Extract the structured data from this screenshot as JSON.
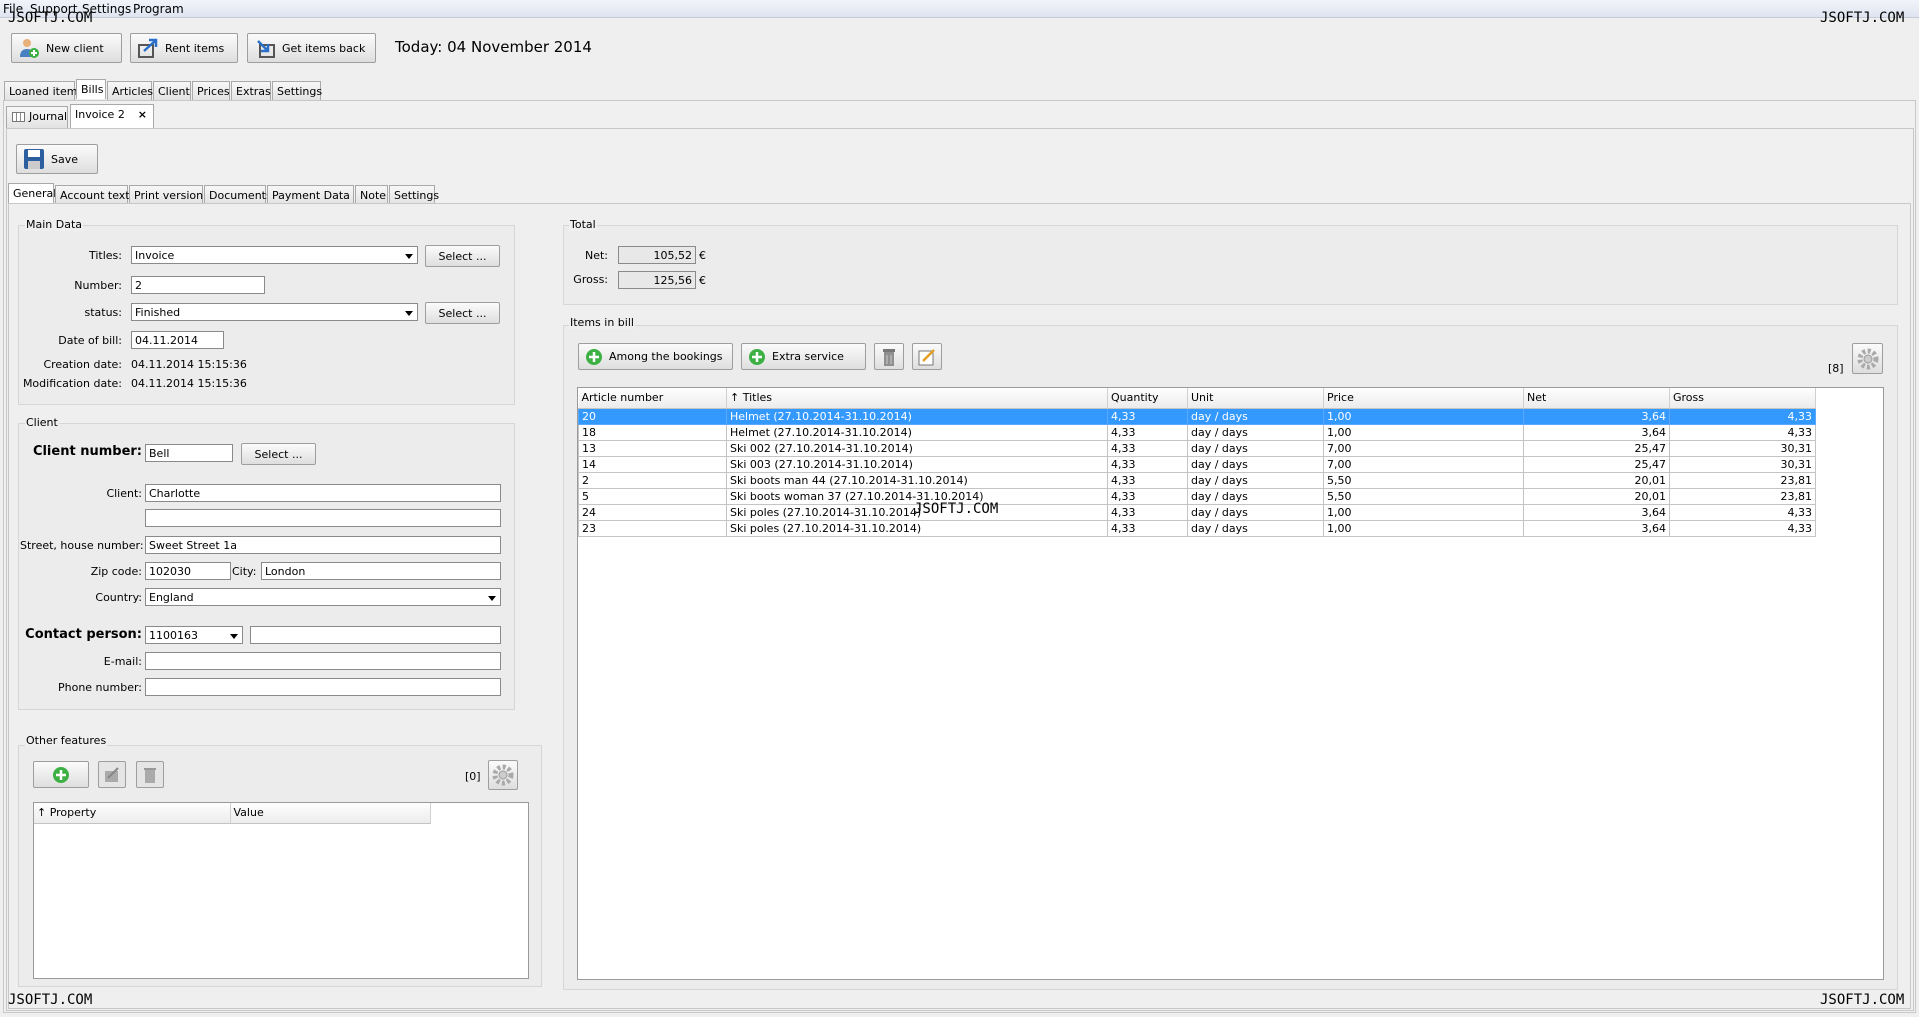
{
  "menu": [
    "File",
    "Support",
    "Settings",
    "Program"
  ],
  "watermark": "JSOFTJ.COM",
  "toolbar": {
    "new_client": "New client",
    "rent_items": "Rent items",
    "get_items_back": "Get items back",
    "today": "Today: 04 November 2014"
  },
  "main_tabs": [
    "Loaned items",
    "Bills",
    "Articles",
    "Client",
    "Prices",
    "Extras",
    "Settings"
  ],
  "doc_tabs": {
    "journal": "Journal",
    "invoice": "Invoice 2",
    "close": "×"
  },
  "save_label": "Save",
  "sub_tabs": [
    "General",
    "Account text",
    "Print version",
    "Documents",
    "Payment Data",
    "Note",
    "Settings"
  ],
  "main_data": {
    "title": "Main Data",
    "titles_label": "Titles:",
    "titles_value": "Invoice",
    "select_label": "Select ...",
    "number_label": "Number:",
    "number_value": "2",
    "status_label": "status:",
    "status_value": "Finished",
    "date_label": "Date of bill:",
    "date_value": "04.11.2014",
    "creation_label": "Creation date:",
    "creation_value": "04.11.2014  15:15:36",
    "mod_label": "Modification date:",
    "mod_value": "04.11.2014  15:15:36"
  },
  "client": {
    "title": "Client",
    "number_label": "Client number:",
    "number_value": "Bell",
    "select_label": "Select ...",
    "client_label": "Client:",
    "client_value": "Charlotte",
    "client_value2": "",
    "street_label": "Street, house number:",
    "street_value": "Sweet Street 1a",
    "zip_label": "Zip code:",
    "zip_value": "102030",
    "city_label": "City:",
    "city_value": "London",
    "country_label": "Country:",
    "country_value": "England",
    "contact_label": "Contact person:",
    "contact_value": "1100163",
    "contact_extra": "",
    "email_label": "E-mail:",
    "email_value": "",
    "phone_label": "Phone number:",
    "phone_value": ""
  },
  "other": {
    "title": "Other features",
    "count": "[0]",
    "columns": [
      "↑ Property",
      "Value"
    ]
  },
  "total": {
    "title": "Total",
    "net_label": "Net:",
    "net_value": "105,52",
    "gross_label": "Gross:",
    "gross_value": "125,56",
    "currency": "€"
  },
  "items": {
    "title": "Items in bill",
    "among_bookings": "Among the bookings",
    "extra_service": "Extra service",
    "count": "[8]",
    "columns": [
      "Article number",
      "↑ Titles",
      "Quantity",
      "Unit",
      "Price",
      "Net",
      "Gross"
    ],
    "rows": [
      [
        "20",
        "Helmet (27.10.2014-31.10.2014)",
        "4,33",
        "day / days",
        "1,00",
        "3,64",
        "4,33"
      ],
      [
        "18",
        "Helmet (27.10.2014-31.10.2014)",
        "4,33",
        "day / days",
        "1,00",
        "3,64",
        "4,33"
      ],
      [
        "13",
        "Ski 002 (27.10.2014-31.10.2014)",
        "4,33",
        "day / days",
        "7,00",
        "25,47",
        "30,31"
      ],
      [
        "14",
        "Ski 003 (27.10.2014-31.10.2014)",
        "4,33",
        "day / days",
        "7,00",
        "25,47",
        "30,31"
      ],
      [
        "2",
        "Ski boots man 44 (27.10.2014-31.10.2014)",
        "4,33",
        "day / days",
        "5,50",
        "20,01",
        "23,81"
      ],
      [
        "5",
        "Ski boots woman 37 (27.10.2014-31.10.2014)",
        "4,33",
        "day / days",
        "5,50",
        "20,01",
        "23,81"
      ],
      [
        "24",
        "Ski poles (27.10.2014-31.10.2014)",
        "4,33",
        "day / days",
        "1,00",
        "3,64",
        "4,33"
      ],
      [
        "23",
        "Ski poles (27.10.2014-31.10.2014)",
        "4,33",
        "day / days",
        "1,00",
        "3,64",
        "4,33"
      ]
    ]
  },
  "colors": {
    "selection": "#3399ff",
    "add_green": "#3cb043"
  }
}
